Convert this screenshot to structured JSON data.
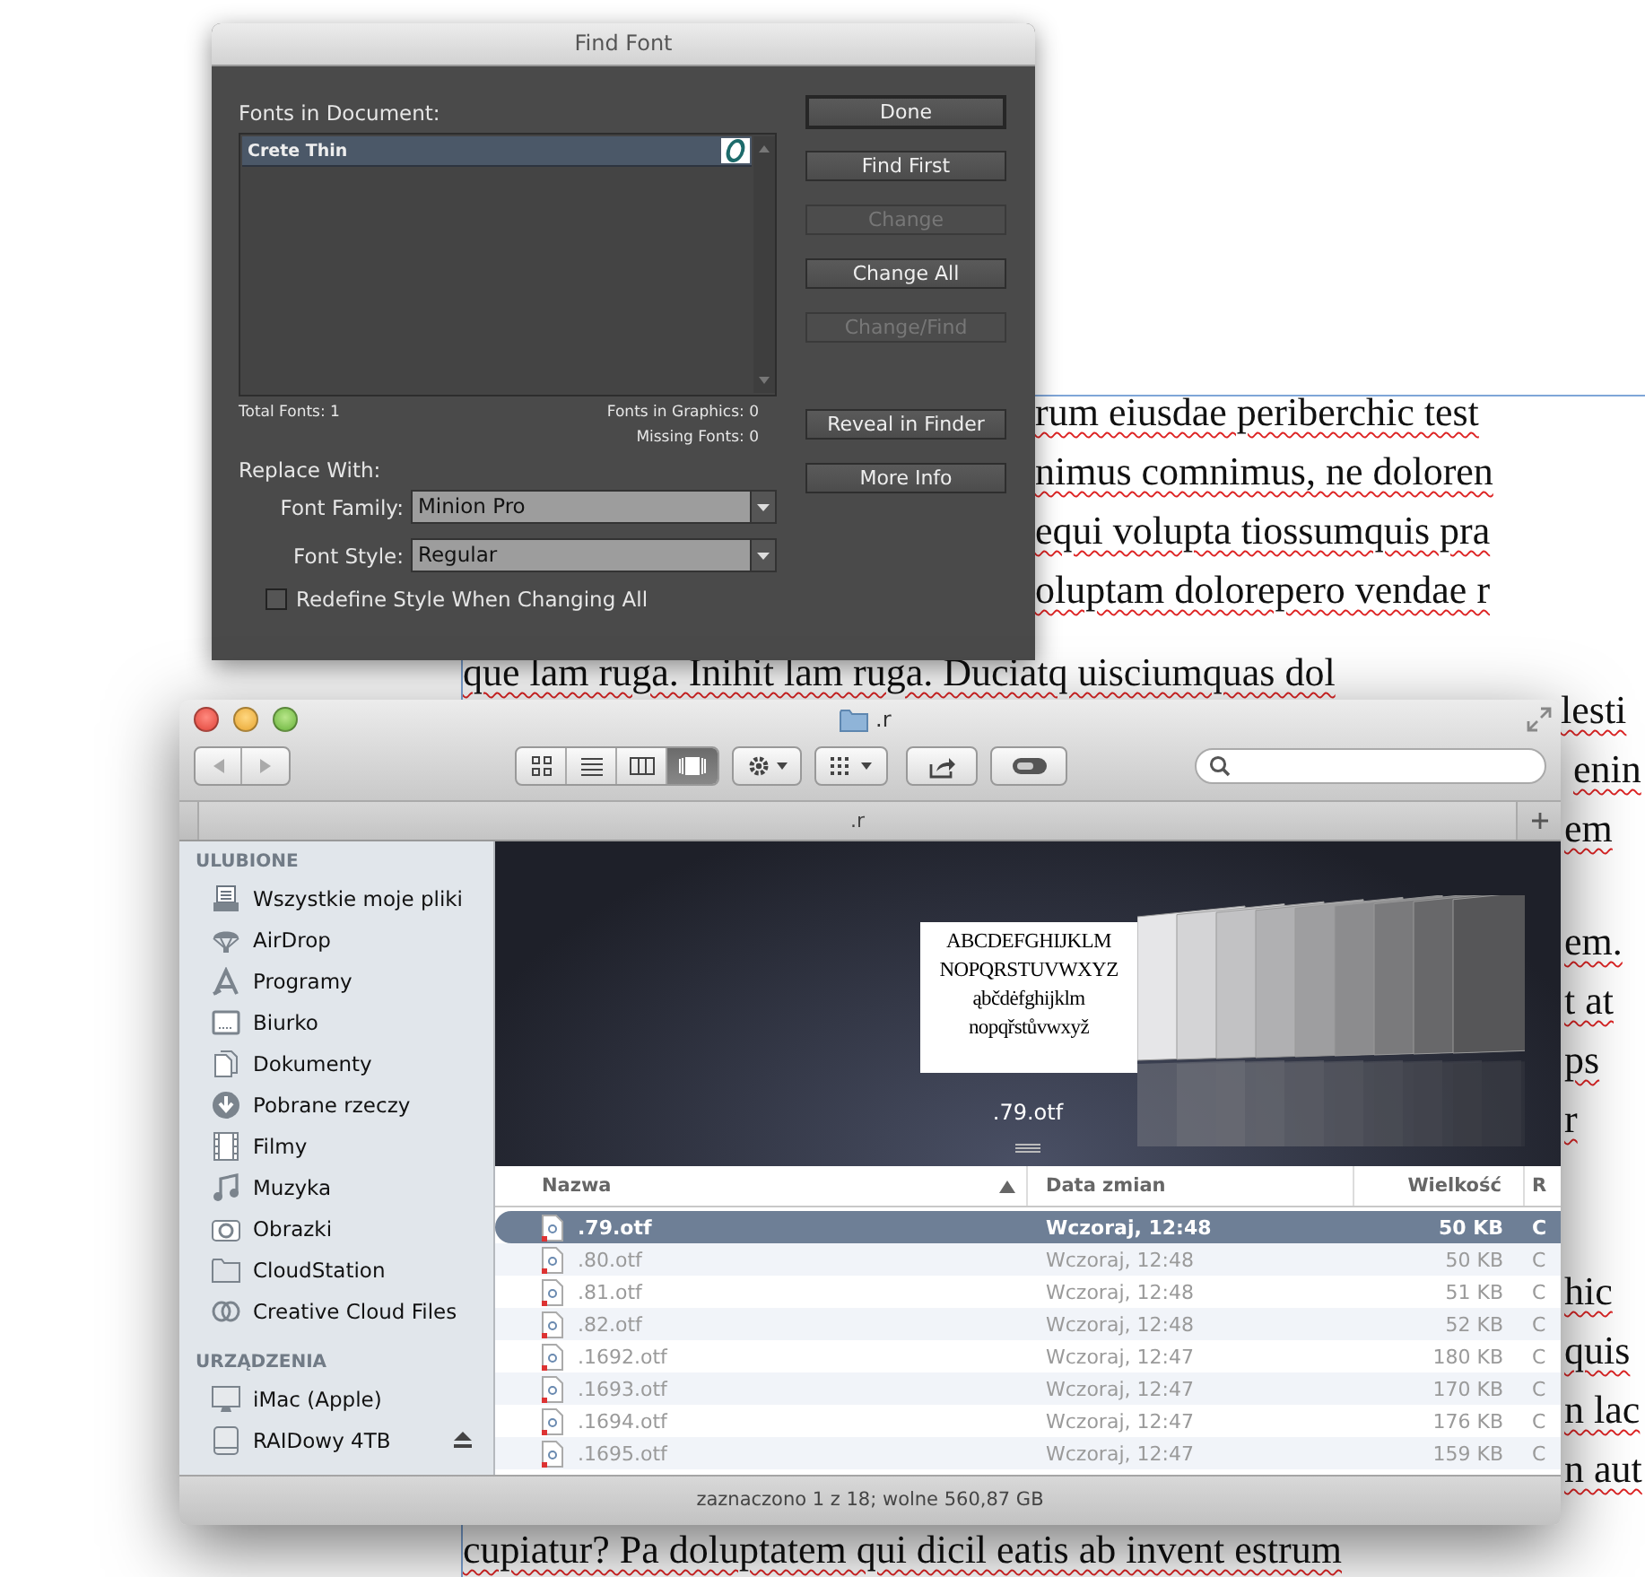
{
  "document": {
    "fragments": [
      "rum eiusdae periberchic test",
      "nimus comnimus, ne doloren",
      "equi volupta tiossumquis pra",
      "oluptam dolorepero vendae r",
      "que lam ruga. Inihit lam ruga. Duciatq uisciumquas dol",
      "lesti",
      "enin",
      "em",
      "em.",
      "t at",
      "ps",
      "r",
      "hic",
      "quis",
      "n lac",
      "n aut",
      "cupiatur? Pa doluptatem qui dicil eatis ab invent estrum"
    ]
  },
  "find_font": {
    "title": "Find Font",
    "fonts_label": "Fonts in Document:",
    "fonts": [
      {
        "name": "Crete Thin",
        "selected": true
      }
    ],
    "total_fonts": "Total Fonts: 1",
    "fonts_in_graphics": "Fonts in Graphics: 0",
    "missing_fonts": "Missing Fonts: 0",
    "replace_label": "Replace With:",
    "family_label": "Font Family:",
    "family_value": "Minion Pro",
    "style_label": "Font Style:",
    "style_value": "Regular",
    "redefine": {
      "label": "Redefine Style When Changing All",
      "checked": false
    },
    "buttons": [
      {
        "label": "Done",
        "default": true,
        "disabled": false
      },
      {
        "label": "Find First",
        "default": false,
        "disabled": false
      },
      {
        "label": "Change",
        "default": false,
        "disabled": true
      },
      {
        "label": "Change All",
        "default": false,
        "disabled": false
      },
      {
        "label": "Change/Find",
        "default": false,
        "disabled": true
      }
    ],
    "buttons_2": [
      {
        "label": "Reveal in Finder",
        "disabled": false
      },
      {
        "label": "More Info",
        "disabled": false
      }
    ]
  },
  "finder": {
    "title": ".r",
    "tab_label": ".r",
    "view_modes": [
      {
        "selected": false
      },
      {
        "selected": false
      },
      {
        "selected": false
      },
      {
        "selected": true
      }
    ],
    "sidebar": [
      {
        "heading": "ULUBIONE",
        "items": [
          {
            "label": "Wszystkie moje pliki",
            "kind": "allfiles",
            "selected": false
          },
          {
            "label": "AirDrop",
            "kind": "airdrop",
            "selected": false
          },
          {
            "label": "Programy",
            "kind": "apps",
            "selected": false
          },
          {
            "label": "Biurko",
            "kind": "desktop",
            "selected": false
          },
          {
            "label": "Dokumenty",
            "kind": "documents",
            "selected": false
          },
          {
            "label": "Pobrane rzeczy",
            "kind": "downloads",
            "selected": false
          },
          {
            "label": "Filmy",
            "kind": "movies",
            "selected": false
          },
          {
            "label": "Muzyka",
            "kind": "music",
            "selected": false
          },
          {
            "label": "Obrazki",
            "kind": "pictures",
            "selected": false
          },
          {
            "label": "CloudStation",
            "kind": "folder",
            "selected": false
          },
          {
            "label": "Creative Cloud Files",
            "kind": "cloud",
            "selected": false
          }
        ]
      },
      {
        "heading": "URZĄDZENIA",
        "items": [
          {
            "label": "iMac (Apple)",
            "kind": "computer",
            "selected": false
          },
          {
            "label": "RAIDowy 4TB",
            "kind": "disk",
            "selected": false,
            "ejectable": true
          }
        ]
      }
    ],
    "preview": {
      "lines": [
        "ABCDEFGHIJKLM",
        "NOPQRSTUVWXYZ",
        "ąbčdėfghijklm",
        "nopqřstůvwxyž"
      ],
      "caption": ".79.otf"
    },
    "columns": [
      {
        "label": "Nazwa",
        "sorted": true
      },
      {
        "label": "Data zmian",
        "sorted": false
      },
      {
        "label": "Wielkość",
        "sorted": false
      },
      {
        "label": "R",
        "sorted": false
      }
    ],
    "rows": [
      {
        "name": ".79.otf",
        "date": "Wczoraj, 12:48",
        "size": "50 KB",
        "column_4": "C",
        "selected": true
      },
      {
        "name": ".80.otf",
        "date": "Wczoraj, 12:48",
        "size": "50 KB",
        "column_4": "C",
        "selected": false
      },
      {
        "name": ".81.otf",
        "date": "Wczoraj, 12:48",
        "size": "51 KB",
        "column_4": "C",
        "selected": false
      },
      {
        "name": ".82.otf",
        "date": "Wczoraj, 12:48",
        "size": "52 KB",
        "column_4": "C",
        "selected": false
      },
      {
        "name": ".1692.otf",
        "date": "Wczoraj, 12:47",
        "size": "180 KB",
        "column_4": "C",
        "selected": false
      },
      {
        "name": ".1693.otf",
        "date": "Wczoraj, 12:47",
        "size": "170 KB",
        "column_4": "C",
        "selected": false
      },
      {
        "name": ".1694.otf",
        "date": "Wczoraj, 12:47",
        "size": "176 KB",
        "column_4": "C",
        "selected": false
      },
      {
        "name": ".1695.otf",
        "date": "Wczoraj, 12:47",
        "size": "159 KB",
        "column_4": "C",
        "selected": false
      }
    ],
    "status": "zaznaczono 1 z 18; wolne 560,87 GB"
  }
}
